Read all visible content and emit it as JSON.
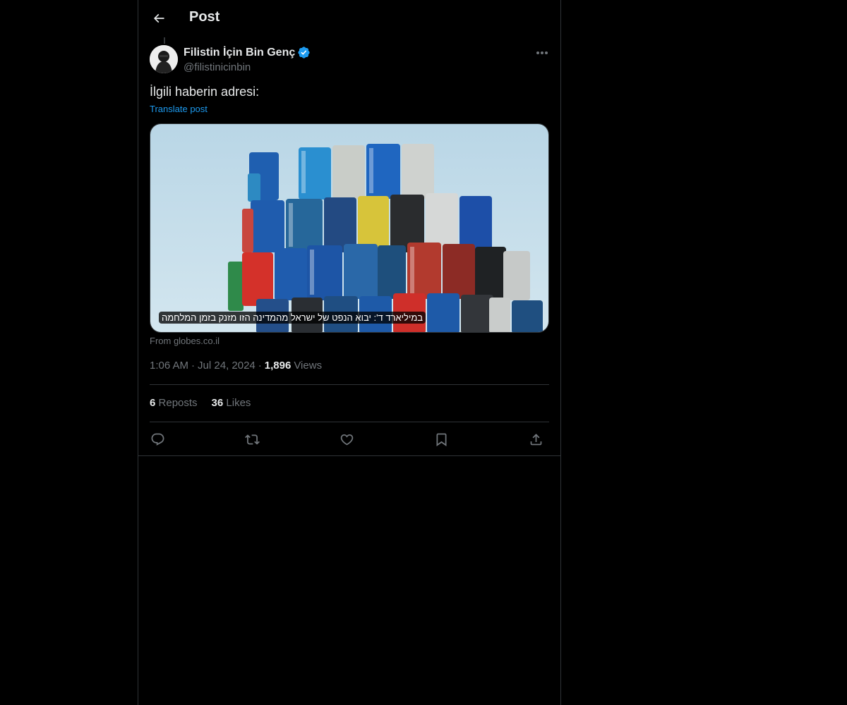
{
  "header": {
    "title": "Post",
    "back_icon": "arrow-left-icon"
  },
  "author": {
    "name": "Filistin İçin Bin Genç",
    "handle": "@filistinicinbin",
    "verified": true,
    "verified_color": "#1d9bf0"
  },
  "post": {
    "text": "İlgili haberin adresi:",
    "translate_label": "Translate post"
  },
  "card": {
    "caption": "במיליארד ד': יבוא הנפט של ישראל מהמדינה הזו מזנק בזמן המלחמה",
    "source": "From globes.co.il"
  },
  "meta": {
    "time": "1:06 AM",
    "dot1": "·",
    "date": "Jul 24, 2024",
    "dot2": "·",
    "views_count": "1,896",
    "views_label": "Views"
  },
  "stats": {
    "reposts_count": "6",
    "reposts_label": "Reposts",
    "likes_count": "36",
    "likes_label": "Likes"
  },
  "actions": {
    "reply": "reply-icon",
    "repost": "repost-icon",
    "like": "heart-icon",
    "bookmark": "bookmark-icon",
    "share": "share-icon"
  },
  "colors": {
    "background": "#000000",
    "text": "#e7e9ea",
    "secondary": "#71767b",
    "accent": "#1d9bf0",
    "border": "#2f3336"
  }
}
